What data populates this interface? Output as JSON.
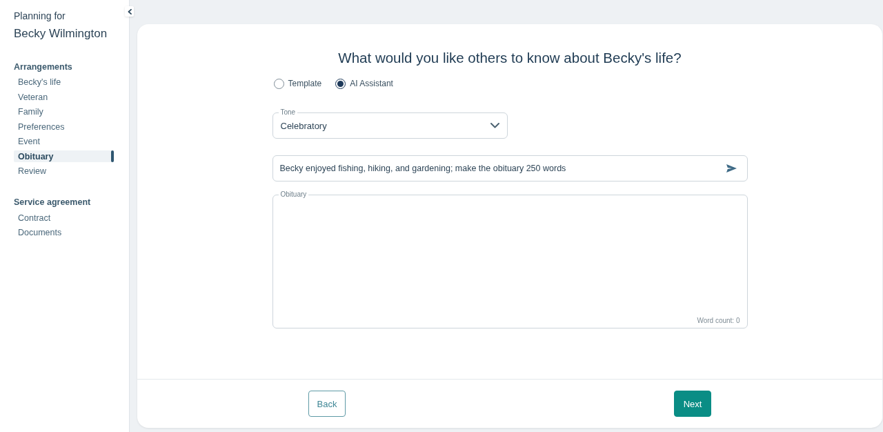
{
  "sidebar": {
    "heading": "Planning for",
    "name": "Becky Wilmington",
    "sections": [
      {
        "title": "Arrangements",
        "items": [
          {
            "label": "Becky's life",
            "selected": false
          },
          {
            "label": "Veteran",
            "selected": false
          },
          {
            "label": "Family",
            "selected": false
          },
          {
            "label": "Preferences",
            "selected": false
          },
          {
            "label": "Event",
            "selected": false
          },
          {
            "label": "Obituary",
            "selected": true
          },
          {
            "label": "Review",
            "selected": false
          }
        ]
      },
      {
        "title": "Service agreement",
        "items": [
          {
            "label": "Contract",
            "selected": false
          },
          {
            "label": "Documents",
            "selected": false
          }
        ]
      }
    ]
  },
  "form": {
    "title": "What would you like others to know about Becky's life?",
    "modes": [
      {
        "label": "Template",
        "selected": false
      },
      {
        "label": "AI Assistant",
        "selected": true
      }
    ],
    "tone": {
      "label": "Tone",
      "value": "Celebratory"
    },
    "prompt": {
      "value": "Becky enjoyed fishing, hiking, and gardening; make the obituary 250 words"
    },
    "obituary": {
      "label": "Obituary",
      "word_count": "Word count: 0"
    }
  },
  "footer_buttons": [
    {
      "label": "Back",
      "kind": "outline"
    },
    {
      "label": "Next",
      "kind": "primary"
    }
  ]
}
